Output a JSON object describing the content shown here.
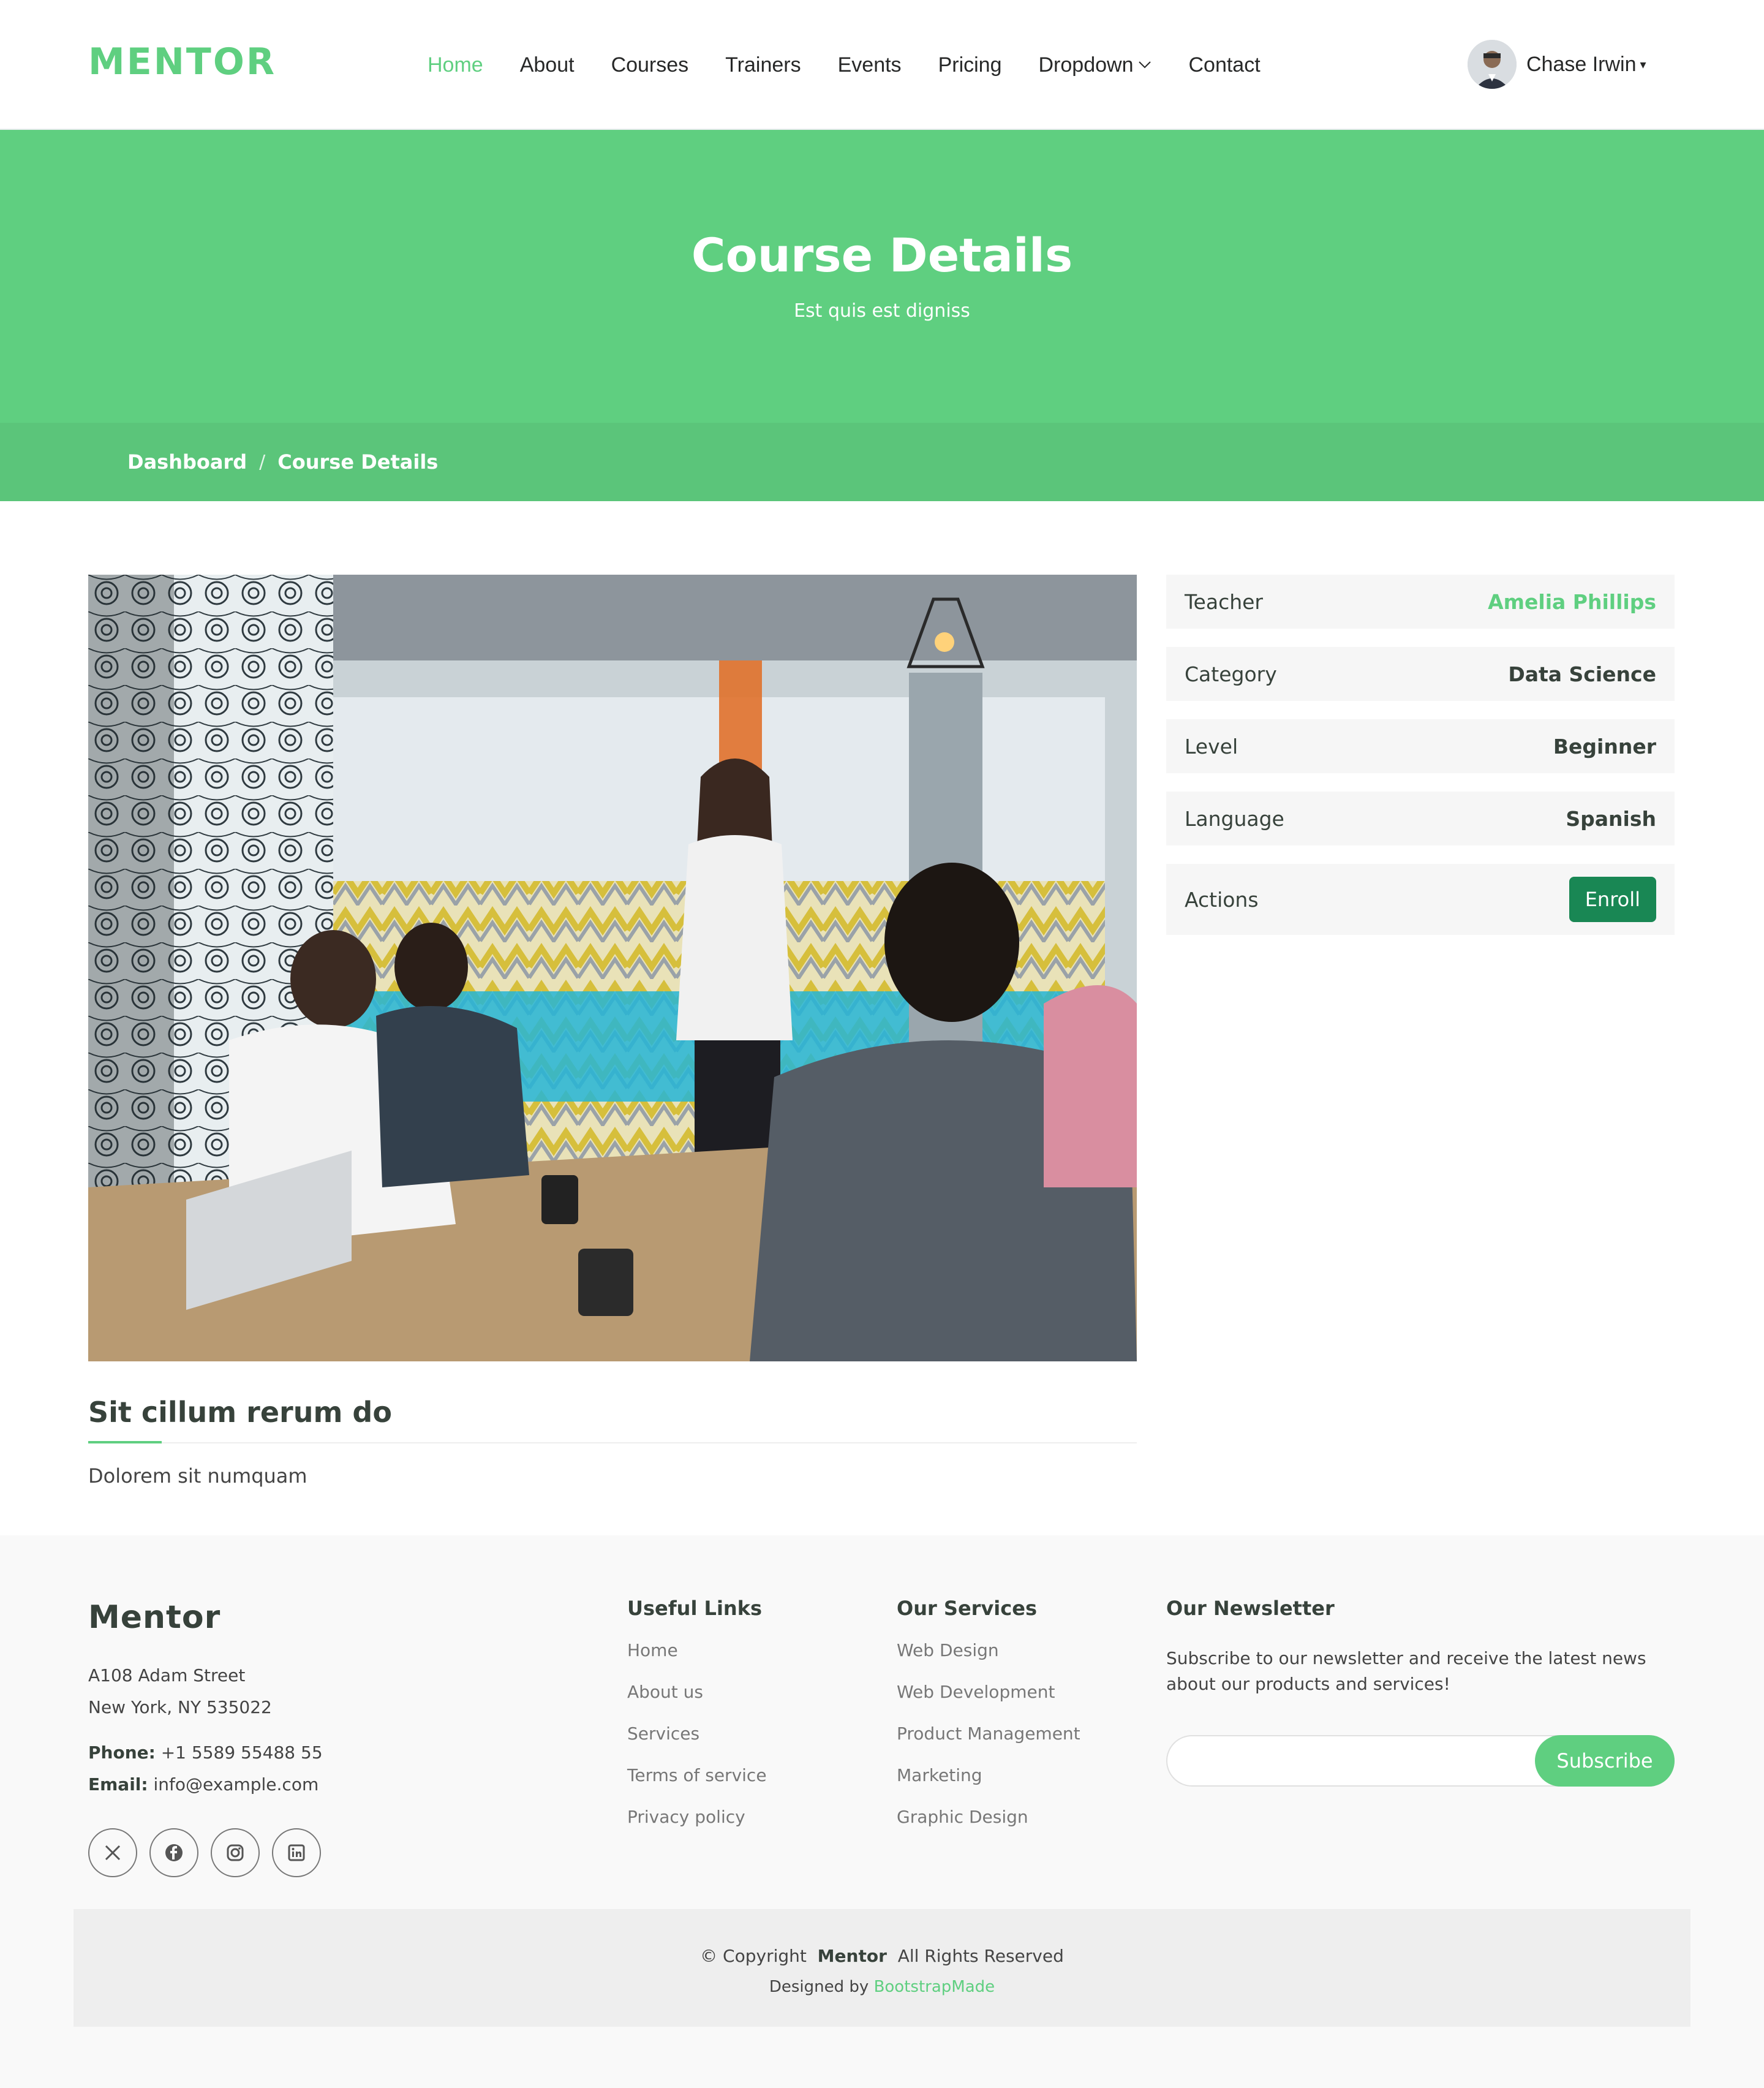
{
  "header": {
    "logo": "MENTOR",
    "nav": [
      {
        "label": "Home",
        "active": true
      },
      {
        "label": "About"
      },
      {
        "label": "Courses"
      },
      {
        "label": "Trainers"
      },
      {
        "label": "Events"
      },
      {
        "label": "Pricing"
      },
      {
        "label": "Dropdown",
        "has_menu": true
      },
      {
        "label": "Contact"
      }
    ],
    "user": {
      "name": "Chase Irwin"
    }
  },
  "hero": {
    "title": "Course Details",
    "subtitle": "Est quis est digniss"
  },
  "breadcrumb": {
    "items": [
      "Dashboard",
      "Course Details"
    ],
    "separator": "/"
  },
  "course": {
    "heading": "Sit cillum rerum do",
    "description": "Dolorem sit numquam",
    "info": [
      {
        "label": "Teacher",
        "value": "Amelia Phillips"
      },
      {
        "label": "Category",
        "value": "Data Science"
      },
      {
        "label": "Level",
        "value": "Beginner"
      },
      {
        "label": "Language",
        "value": "Spanish"
      }
    ],
    "actions_label": "Actions",
    "enroll_label": "Enroll"
  },
  "footer": {
    "brand": "Mentor",
    "address_line1": "A108 Adam Street",
    "address_line2": "New York, NY 535022",
    "phone_label": "Phone:",
    "phone": "+1 5589 55488 55",
    "email_label": "Email:",
    "email": "info@example.com",
    "socials": [
      "x-icon",
      "facebook-icon",
      "instagram-icon",
      "linkedin-icon"
    ],
    "useful_links": {
      "title": "Useful Links",
      "items": [
        "Home",
        "About us",
        "Services",
        "Terms of service",
        "Privacy policy"
      ]
    },
    "services": {
      "title": "Our Services",
      "items": [
        "Web Design",
        "Web Development",
        "Product Management",
        "Marketing",
        "Graphic Design"
      ]
    },
    "newsletter": {
      "title": "Our Newsletter",
      "text": "Subscribe to our newsletter and receive the latest news about our products and services!",
      "button": "Subscribe"
    },
    "copyright_prefix": "© Copyright",
    "copyright_brand": "Mentor",
    "copyright_suffix": "All Rights Reserved",
    "designed_by": "Designed by",
    "designer": "BootstrapMade"
  },
  "colors": {
    "accent": "#5fcf80",
    "breadcrumb_bg": "#5bc57a",
    "enroll": "#198754"
  }
}
